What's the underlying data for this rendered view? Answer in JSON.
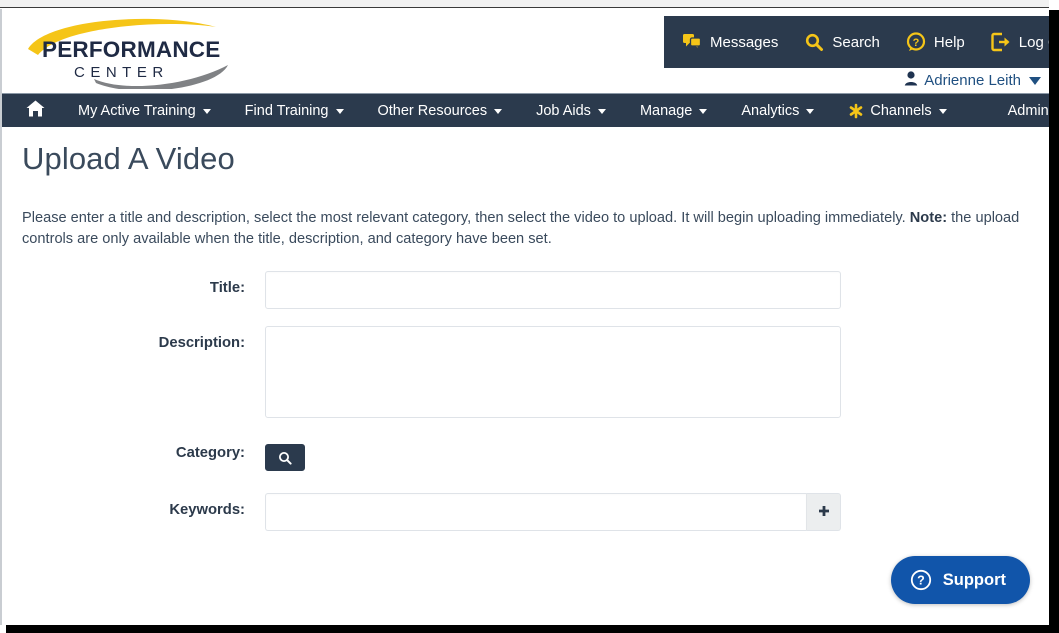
{
  "header": {
    "logo": {
      "primary_text": "PERFORMANCE",
      "secondary_text": "CENTER",
      "accent_color": "#f5c518",
      "swoosh_color": "#808285",
      "text_color": "#1f2a44"
    },
    "utility_nav": [
      {
        "label": "Messages",
        "icon": "messages-icon"
      },
      {
        "label": "Search",
        "icon": "search-icon"
      },
      {
        "label": "Help",
        "icon": "help-icon"
      },
      {
        "label": "Log Off",
        "icon": "logout-icon"
      }
    ],
    "user": {
      "name": "Adrienne Leith",
      "icon": "user-icon",
      "link_color": "#205081"
    }
  },
  "navbar": {
    "background": "#2b3a4d",
    "items": [
      {
        "label": "",
        "icon": "home-icon",
        "has_caret": false
      },
      {
        "label": "My Active Training",
        "has_caret": true
      },
      {
        "label": "Find Training",
        "has_caret": true
      },
      {
        "label": "Other Resources",
        "has_caret": true
      },
      {
        "label": "Job Aids",
        "has_caret": true
      },
      {
        "label": "Manage",
        "has_caret": true
      },
      {
        "label": "Analytics",
        "has_caret": true
      },
      {
        "label": "Channels",
        "icon": "channels-asterisk-icon",
        "has_caret": true
      },
      {
        "label": "Admin",
        "has_caret": false
      }
    ]
  },
  "main": {
    "page_title": "Upload A Video",
    "intro": {
      "part1": "Please enter a title and description, select the most relevant category, then select the video to upload. It will begin uploading immediately. ",
      "note_label": "Note:",
      "part2": " the upload controls are only available when the title, description, and category have been set."
    },
    "form": {
      "title": {
        "label": "Title:",
        "value": "",
        "placeholder": ""
      },
      "description": {
        "label": "Description:",
        "value": "",
        "placeholder": ""
      },
      "category": {
        "label": "Category:",
        "button_icon": "search-icon",
        "value": ""
      },
      "keywords": {
        "label": "Keywords:",
        "value": "",
        "placeholder": "",
        "add_icon": "plus-icon"
      }
    }
  },
  "support": {
    "label": "Support",
    "icon": "question-circle-icon",
    "color": "#1155aa"
  }
}
